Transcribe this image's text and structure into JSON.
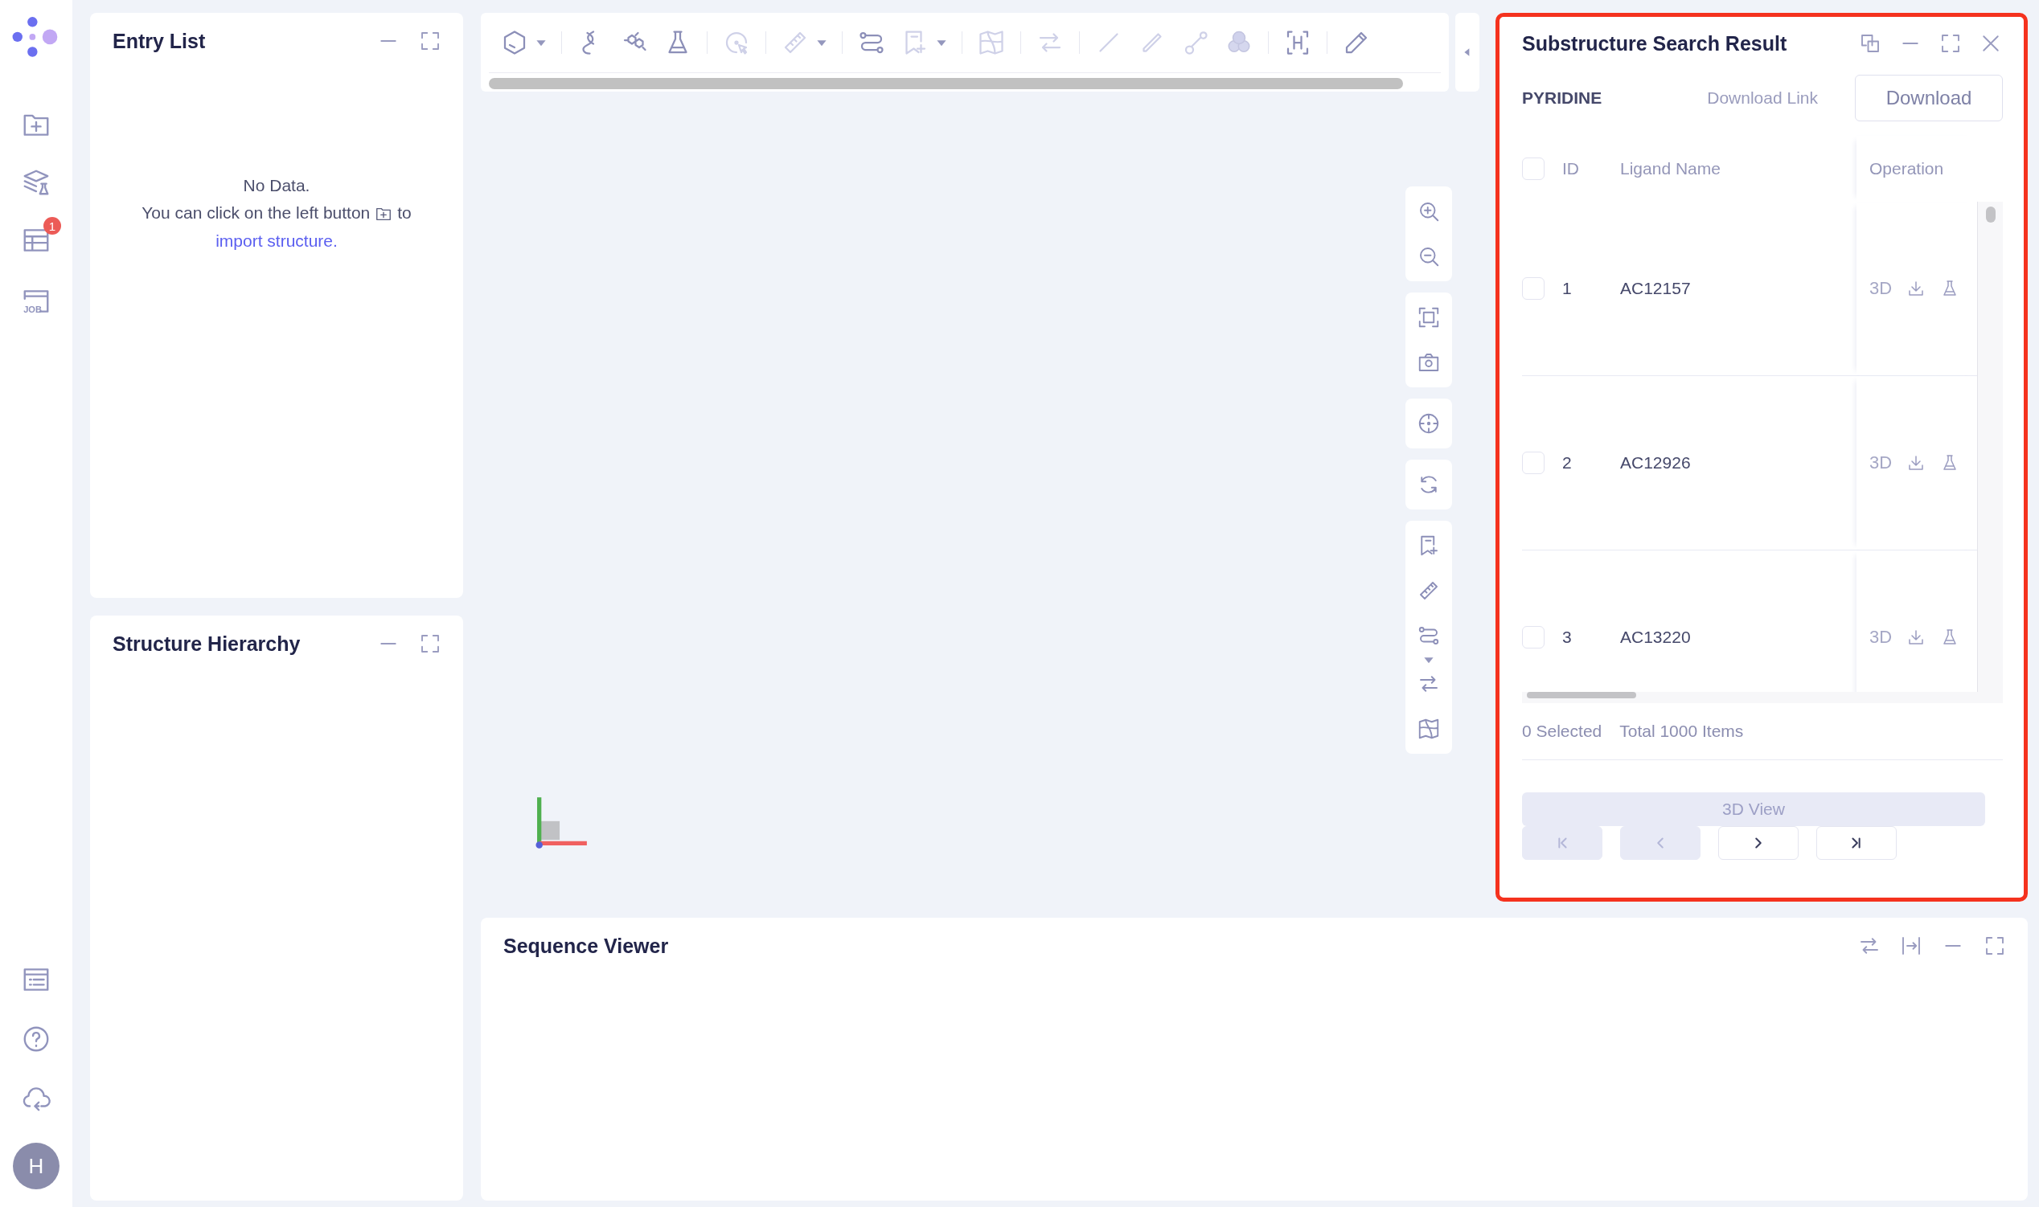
{
  "sidebar": {
    "badge": "1",
    "job_icon_text": "JOB",
    "avatar": "H"
  },
  "entry_list": {
    "title": "Entry List",
    "empty": "No Data.",
    "hint_start": "You can click on the left button",
    "hint_end": "to",
    "link": "import structure."
  },
  "structure_hierarchy": {
    "title": "Structure Hierarchy"
  },
  "result_panel": {
    "title": "Substructure Search Result",
    "query": "PYRIDINE",
    "download_link": "Download Link",
    "download_button": "Download",
    "select_all": {
      "checked": false
    },
    "columns": [
      "ID",
      "Ligand Name",
      "Operation"
    ],
    "rows": [
      {
        "id": "1",
        "name": "AC12157",
        "action": "3D",
        "checked": false
      },
      {
        "id": "2",
        "name": "AC12926",
        "action": "3D",
        "checked": false
      },
      {
        "id": "3",
        "name": "AC13220",
        "action": "3D",
        "checked": false
      }
    ],
    "selected": "0 Selected",
    "total": "Total 1000 Items",
    "view_button": {
      "label": "3D View",
      "disabled": true
    },
    "pager": [
      {
        "kind": "first",
        "disabled": true
      },
      {
        "kind": "prev",
        "disabled": true
      },
      {
        "kind": "next",
        "disabled": false
      },
      {
        "kind": "last",
        "disabled": false
      }
    ]
  },
  "sequence_viewer": {
    "title": "Sequence Viewer"
  }
}
